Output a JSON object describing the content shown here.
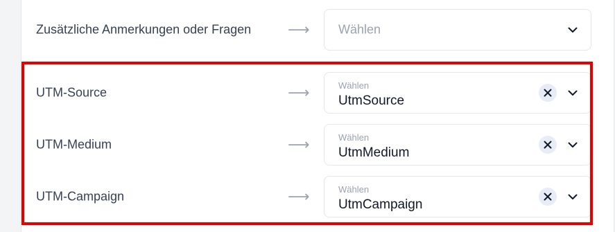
{
  "rows": [
    {
      "label": "Zusätzliche Anmerkungen oder Fragen",
      "arrow": "⟶",
      "placeholder": "Wählen",
      "value": null
    },
    {
      "label": "UTM-Source",
      "arrow": "⟶",
      "placeholder": "Wählen",
      "value": "UtmSource"
    },
    {
      "label": "UTM-Medium",
      "arrow": "⟶",
      "placeholder": "Wählen",
      "value": "UtmMedium"
    },
    {
      "label": "UTM-Campaign",
      "arrow": "⟶",
      "placeholder": "Wählen",
      "value": "UtmCampaign"
    }
  ],
  "icons": {
    "clear": "close-icon",
    "dropdown": "chevron-down-icon",
    "arrow": "arrow-right-icon"
  },
  "colors": {
    "highlight": "#e60000",
    "clear_bg": "#e8ecf7",
    "placeholder": "#9ca3af"
  }
}
